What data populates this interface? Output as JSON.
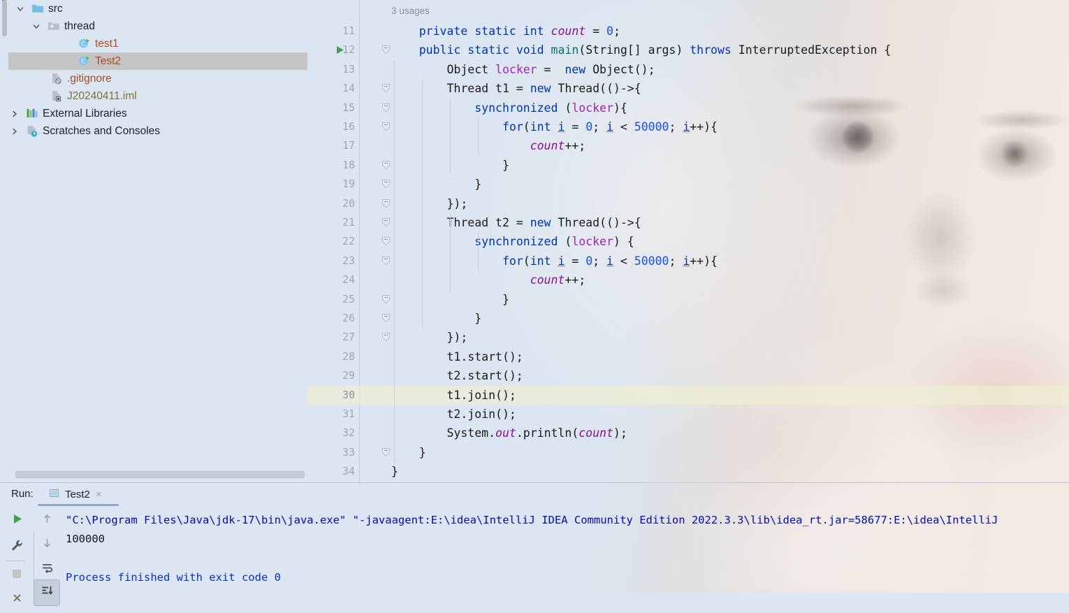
{
  "app": {
    "theme_bg": "#dbe6f2",
    "accent": "#0033b3"
  },
  "sidebar": {
    "items": [
      {
        "label": "src",
        "icon": "folder-blue-icon",
        "twisty": "chevron-down",
        "indent": 33,
        "selected": false,
        "color": ""
      },
      {
        "label": "thread",
        "icon": "package-folder-icon",
        "twisty": "chevron-down",
        "indent": 56,
        "selected": false,
        "color": ""
      },
      {
        "label": "test1",
        "icon": "java-class-runnable-icon",
        "twisty": "",
        "indent": 100,
        "selected": false,
        "color": "orange"
      },
      {
        "label": "Test2",
        "icon": "java-class-runnable-icon",
        "twisty": "",
        "indent": 100,
        "selected": true,
        "color": "orange"
      },
      {
        "label": ".gitignore",
        "icon": "gitignore-file-icon",
        "twisty": "",
        "indent": 60,
        "selected": false,
        "color": "orange"
      },
      {
        "label": "J20240411.iml",
        "icon": "iml-file-icon",
        "twisty": "",
        "indent": 60,
        "selected": false,
        "color": "olive"
      },
      {
        "label": "External Libraries",
        "icon": "libraries-icon",
        "twisty": "chevron-right",
        "indent": 25,
        "selected": false,
        "color": ""
      },
      {
        "label": "Scratches and Consoles",
        "icon": "scratches-icon",
        "twisty": "chevron-right",
        "indent": 25,
        "selected": false,
        "color": ""
      }
    ]
  },
  "editor": {
    "inlay_hint": "3 usages",
    "caret_line": 30,
    "run_marker_line": 12,
    "lines": [
      {
        "n": 11,
        "fold": false,
        "text": "    private static int count = 0;"
      },
      {
        "n": 12,
        "fold": true,
        "text": "    public static void main(String[] args) throws InterruptedException {"
      },
      {
        "n": 13,
        "fold": false,
        "text": "        Object locker =  new Object();"
      },
      {
        "n": 14,
        "fold": true,
        "text": "        Thread t1 = new Thread(()->{"
      },
      {
        "n": 15,
        "fold": true,
        "text": "            synchronized (locker){"
      },
      {
        "n": 16,
        "fold": true,
        "text": "                for(int i = 0; i < 50000; i++){"
      },
      {
        "n": 17,
        "fold": false,
        "text": "                    count++;"
      },
      {
        "n": 18,
        "fold": true,
        "text": "                }"
      },
      {
        "n": 19,
        "fold": true,
        "text": "            }"
      },
      {
        "n": 20,
        "fold": true,
        "text": "        });"
      },
      {
        "n": 21,
        "fold": true,
        "text": "        Thread t2 = new Thread(()->{"
      },
      {
        "n": 22,
        "fold": true,
        "text": "            synchronized (locker) {"
      },
      {
        "n": 23,
        "fold": true,
        "text": "                for(int i = 0; i < 50000; i++){"
      },
      {
        "n": 24,
        "fold": false,
        "text": "                    count++;"
      },
      {
        "n": 25,
        "fold": true,
        "text": "                }"
      },
      {
        "n": 26,
        "fold": true,
        "text": "            }"
      },
      {
        "n": 27,
        "fold": true,
        "text": "        });"
      },
      {
        "n": 28,
        "fold": false,
        "text": "        t1.start();"
      },
      {
        "n": 29,
        "fold": false,
        "text": "        t2.start();"
      },
      {
        "n": 30,
        "fold": false,
        "text": "        t1.join();"
      },
      {
        "n": 31,
        "fold": false,
        "text": "        t2.join();"
      },
      {
        "n": 32,
        "fold": false,
        "text": "        System.out.println(count);"
      },
      {
        "n": 33,
        "fold": true,
        "text": "    }"
      },
      {
        "n": 34,
        "fold": false,
        "text": "}"
      }
    ]
  },
  "run_panel": {
    "title": "Run:",
    "tab": {
      "label": "Test2",
      "close": "×"
    },
    "toolbar_left": [
      {
        "name": "rerun-button",
        "icon": "play-icon"
      },
      {
        "name": "settings-button",
        "icon": "wrench-icon"
      },
      {
        "name": "stop-button",
        "icon": "stop-square-icon"
      },
      {
        "name": "close-button",
        "icon": "close-x-icon"
      }
    ],
    "toolbar_right": [
      {
        "name": "prev-occurrence-button",
        "icon": "arrow-up-icon"
      },
      {
        "name": "next-occurrence-button",
        "icon": "arrow-down-icon"
      },
      {
        "name": "soft-wrap-button",
        "icon": "soft-wrap-icon"
      },
      {
        "name": "scroll-to-end-button",
        "icon": "scroll-to-end-icon"
      }
    ],
    "console_lines": [
      {
        "kind": "cmd",
        "text": "\"C:\\Program Files\\Java\\jdk-17\\bin\\java.exe\" \"-javaagent:E:\\idea\\IntelliJ IDEA Community Edition 2022.3.3\\lib\\idea_rt.jar=58677:E:\\idea\\IntelliJ"
      },
      {
        "kind": "outp",
        "text": "100000"
      },
      {
        "kind": "done",
        "text": "Process finished with exit code 0"
      }
    ]
  }
}
